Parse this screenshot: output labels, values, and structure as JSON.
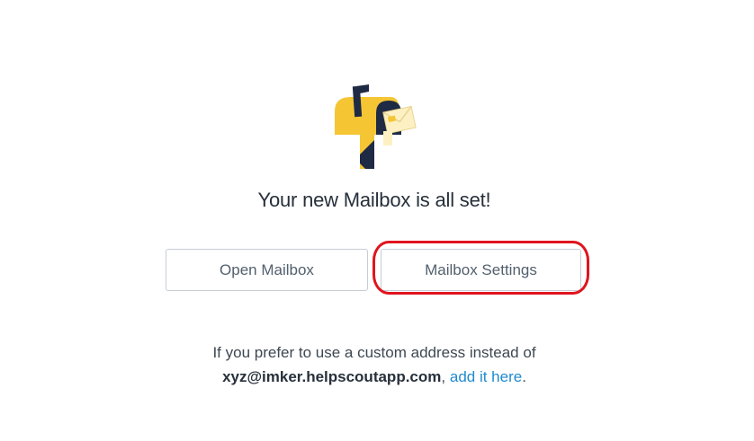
{
  "main": {
    "title": "Your new Mailbox is all set!",
    "open_mailbox_label": "Open Mailbox",
    "mailbox_settings_label": "Mailbox Settings",
    "note_line1": "If you prefer to use a custom address instead of",
    "note_email": "xyz@imker.helpscoutapp.com",
    "note_comma": ",",
    "note_link": "add it here",
    "note_period": "."
  },
  "colors": {
    "mailbox_yellow": "#f5c534",
    "mailbox_navy": "#1f2a44",
    "link_blue": "#1f8ad0",
    "highlight_red": "#e0141e"
  },
  "icons": {
    "illustration": "mailbox-illustration-icon"
  }
}
